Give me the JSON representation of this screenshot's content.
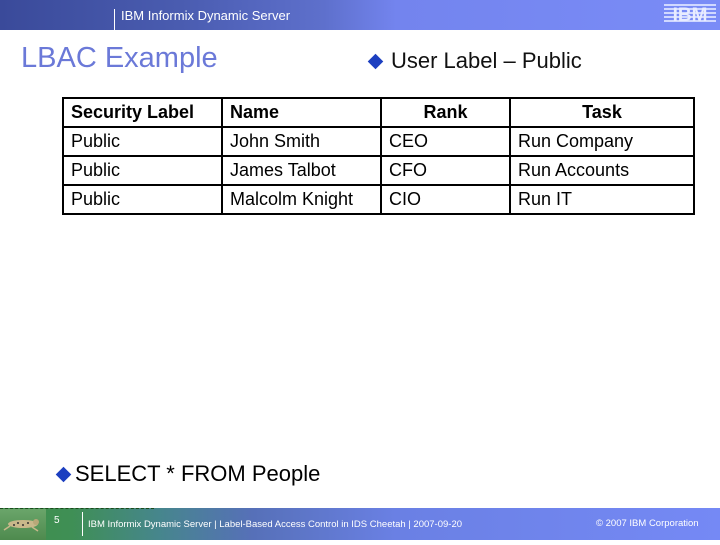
{
  "header": {
    "product": "IBM Informix Dynamic Server",
    "logo_text": "IBM"
  },
  "slide": {
    "title": "LBAC Example",
    "bullet_user_label": "User Label – Public",
    "bullet_query": "SELECT * FROM People"
  },
  "table": {
    "headers": [
      "Security Label",
      "Name",
      "Rank",
      "Task"
    ],
    "rows": [
      [
        "Public",
        "John Smith",
        "CEO",
        "Run Company"
      ],
      [
        "Public",
        "James Talbot",
        "CFO",
        "Run Accounts"
      ],
      [
        "Public",
        "Malcolm Knight",
        "CIO",
        "Run IT"
      ]
    ]
  },
  "footer": {
    "page_number": "5",
    "text": "IBM Informix Dynamic Server | Label-Based Access Control in IDS Cheetah | 2007-09-20",
    "copyright": "© 2007 IBM Corporation"
  },
  "colors": {
    "title": "#6b79d8",
    "bullet": "#1c3fc0",
    "header_bar": "#7a8cf7",
    "footer_green": "#3f8f4a"
  }
}
